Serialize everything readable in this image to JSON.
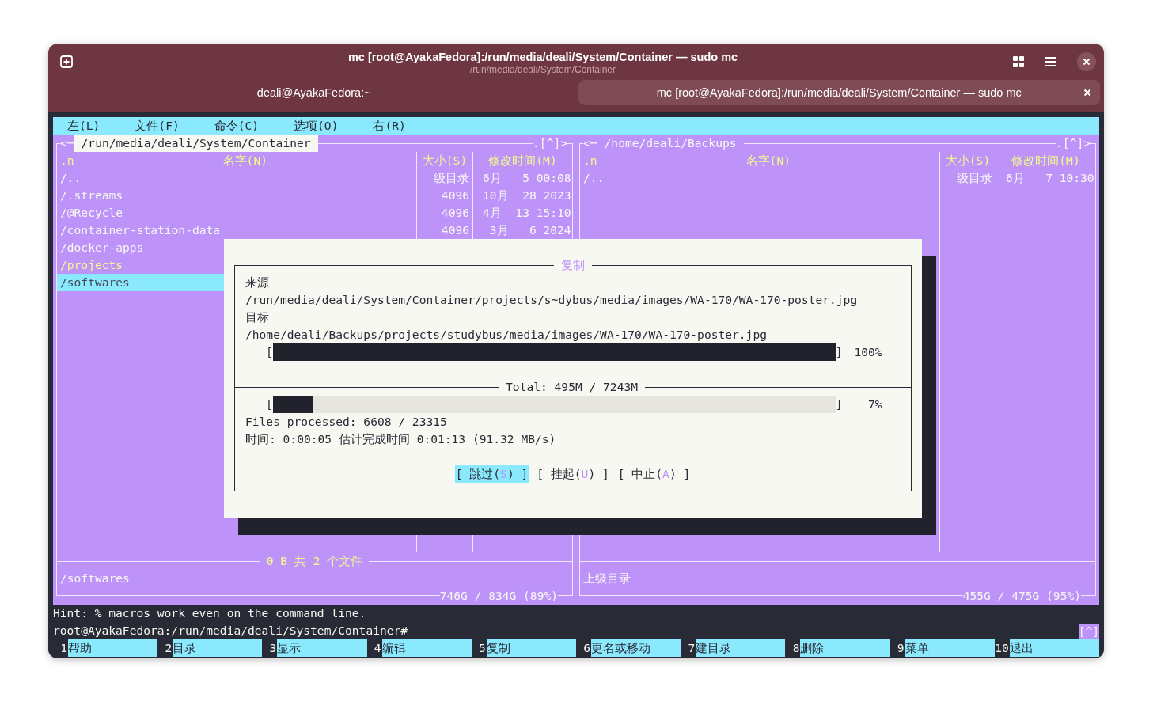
{
  "window": {
    "title": "mc [root@AyakaFedora]:/run/media/deali/System/Container — sudo mc",
    "subtitle": "/run/media/deali/System/Container"
  },
  "tabs": [
    {
      "label": "deali@AyakaFedora:~",
      "selected": false
    },
    {
      "label": "mc [root@AyakaFedora]:/run/media/deali/System/Container — sudo mc",
      "selected": true
    }
  ],
  "menu_bar": [
    "左(L)",
    "文件(F)",
    "命令(C)",
    "选项(O)",
    "右(R)"
  ],
  "panels": [
    {
      "arrow": "<─",
      "path": "/run/media/deali/System/Container",
      "active": true,
      "corner": ".[^]>",
      "columns": [
        ".n",
        "名字(N)",
        "大小(S)",
        "修改时间(M)"
      ],
      "rows": [
        {
          "name": "/..",
          "size": "级目录",
          "modified": "6月   5 00:08",
          "color": "#f8f8f2",
          "selected": false
        },
        {
          "name": "/.streams",
          "size": "4096",
          "modified": "10月  28 2023",
          "color": "#f8f8f2",
          "selected": false
        },
        {
          "name": "/@Recycle",
          "size": "4096",
          "modified": "4月  13 15:10",
          "color": "#f8f8f2",
          "selected": false
        },
        {
          "name": "/container-station-data",
          "size": "4096",
          "modified": " 3月   6 2024",
          "color": "#f8f8f2",
          "selected": false
        },
        {
          "name": "/docker-apps",
          "color": "#f8f8f2",
          "selected": false
        },
        {
          "name": "/projects",
          "color": "#f1fa8c",
          "selected": false
        },
        {
          "name": "/softwares",
          "selected": true
        }
      ],
      "summary": "0 B 共 2 个文件",
      "mini_status": "/softwares",
      "disk": "746G / 834G (89%)"
    },
    {
      "arrow": "<─",
      "path": "/home/deali/Backups",
      "active": false,
      "corner": ".[^]>",
      "columns": [
        ".n",
        "名字(N)",
        "大小(S)",
        "修改时间(M)"
      ],
      "rows": [
        {
          "name": "/..",
          "size": "级目录",
          "modified": "6月   7 10:30",
          "color": "#f8f8f2",
          "selected": false
        }
      ],
      "mini_status": "上级目录",
      "disk": "455G / 475G (95%)"
    }
  ],
  "dialog": {
    "title": "复制",
    "source_label": "来源",
    "source": "/run/media/deali/System/Container/projects/s~dybus/media/images/WA-170/WA-170-poster.jpg",
    "target_label": "目标",
    "target": "/home/deali/Backups/projects/studybus/media/images/WA-170/WA-170-poster.jpg",
    "file_progress": {
      "open": "[",
      "close": "]",
      "level": 1,
      "reading": "100%"
    },
    "total": "Total: 495M / 7243M",
    "total_progress": {
      "open": "[",
      "close": "]",
      "level": 0.07,
      "reading": "7%"
    },
    "files": "Files processed: 6608 / 23315",
    "time": "时间: 0:00:05 估计完成时间 0:01:13 (91.32 MB/s)",
    "buttons": [
      {
        "before": "[ 跳过(",
        "hotkey": "S",
        "after": ") ]",
        "selected": true
      },
      {
        "before": "[ 挂起(",
        "hotkey": "U",
        "after": ") ]",
        "selected": false
      },
      {
        "before": "[ 中止(",
        "hotkey": "A",
        "after": ") ]",
        "selected": false
      }
    ]
  },
  "hint": "Hint: % macros work even on the command line.",
  "prompt": "root@AyakaFedora:/run/media/deali/System/Container#",
  "prompt_marker": "[^]",
  "function_keys": [
    {
      "number": "1",
      "label": "帮助"
    },
    {
      "number": "2",
      "label": "目录"
    },
    {
      "number": "3",
      "label": "显示"
    },
    {
      "number": "4",
      "label": "编辑"
    },
    {
      "number": "5",
      "label": "复制"
    },
    {
      "number": "6",
      "label": "更名或移动"
    },
    {
      "number": "7",
      "label": "建目录"
    },
    {
      "number": "8",
      "label": "删除"
    },
    {
      "number": "9",
      "label": "菜单"
    },
    {
      "number": "10",
      "label": "退出"
    }
  ]
}
